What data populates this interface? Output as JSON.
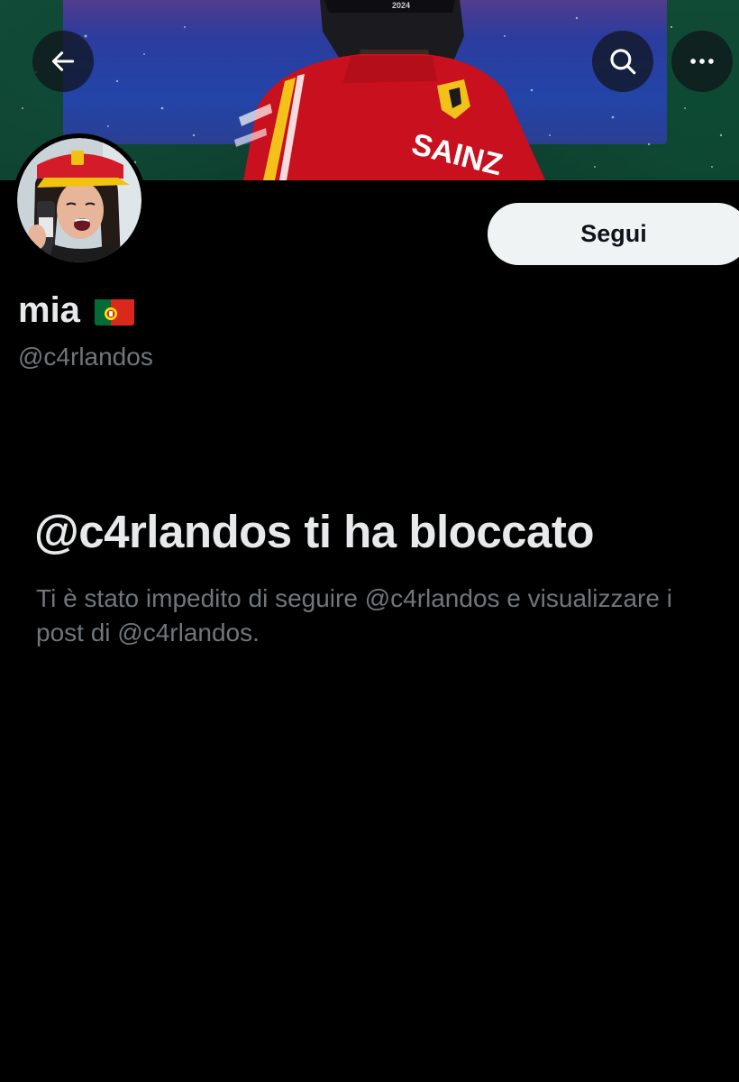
{
  "header": {
    "back_icon": "arrow-left-icon",
    "search_icon": "search-icon",
    "more_icon": "more-horizontal-icon"
  },
  "banner": {
    "jersey_text": "SAINZ",
    "cap_text": "2024"
  },
  "profile": {
    "display_name": "mia",
    "flag": "portugal-flag",
    "handle": "@c4rlandos",
    "follow_label": "Segui"
  },
  "blocked": {
    "title": "@c4rlandos ti ha bloccato",
    "description": "Ti è stato impedito di seguire @c4rlandos e visualizzare i post di @c4rlandos."
  },
  "colors": {
    "background": "#000000",
    "text_primary": "#e7e9ea",
    "text_secondary": "#71767b",
    "follow_bg": "#eff3f4",
    "follow_text": "#0f1419"
  }
}
